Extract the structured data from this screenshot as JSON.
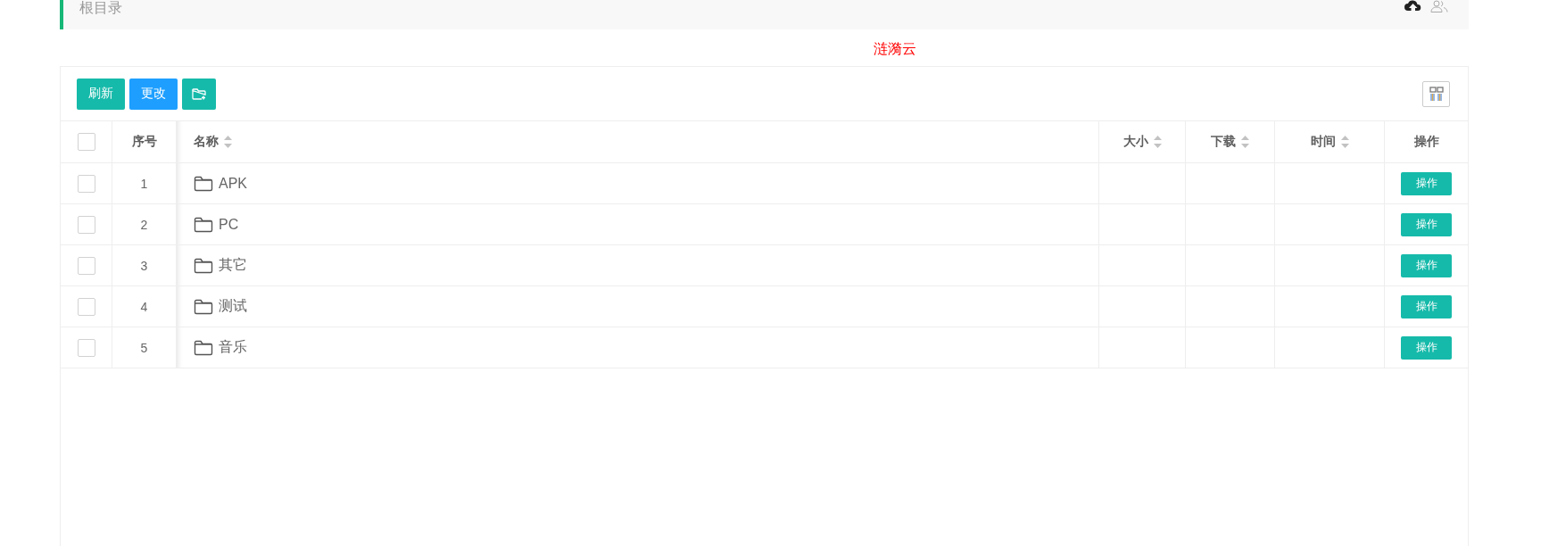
{
  "breadcrumb": {
    "title": "根目录"
  },
  "brand": {
    "text": "涟漪云"
  },
  "toolbar": {
    "buttons": [
      {
        "kind": "default",
        "label": "刷新"
      },
      {
        "kind": "normal",
        "label": "更改"
      },
      {
        "kind": "folder"
      }
    ]
  },
  "table": {
    "columns": [
      {
        "kind": "checkbox",
        "checked": false
      },
      {
        "kind": "text",
        "label": "序号",
        "sortable": false
      },
      {
        "kind": "text",
        "label": "名称",
        "sortable": true
      },
      {
        "kind": "text",
        "label": "大小",
        "sortable": true
      },
      {
        "kind": "text",
        "label": "下载",
        "sortable": true
      },
      {
        "kind": "text",
        "label": "时间",
        "sortable": true
      },
      {
        "kind": "text",
        "label": "操作",
        "sortable": false
      }
    ],
    "rows": [
      {
        "checked": false,
        "index": "1",
        "name": "APK",
        "action": "操作"
      },
      {
        "checked": false,
        "index": "2",
        "name": "PC",
        "action": "操作"
      },
      {
        "checked": false,
        "index": "3",
        "name": "其它",
        "action": "操作"
      },
      {
        "checked": false,
        "index": "4",
        "name": "测试",
        "action": "操作"
      },
      {
        "checked": false,
        "index": "5",
        "name": "音乐",
        "action": "操作"
      }
    ]
  }
}
